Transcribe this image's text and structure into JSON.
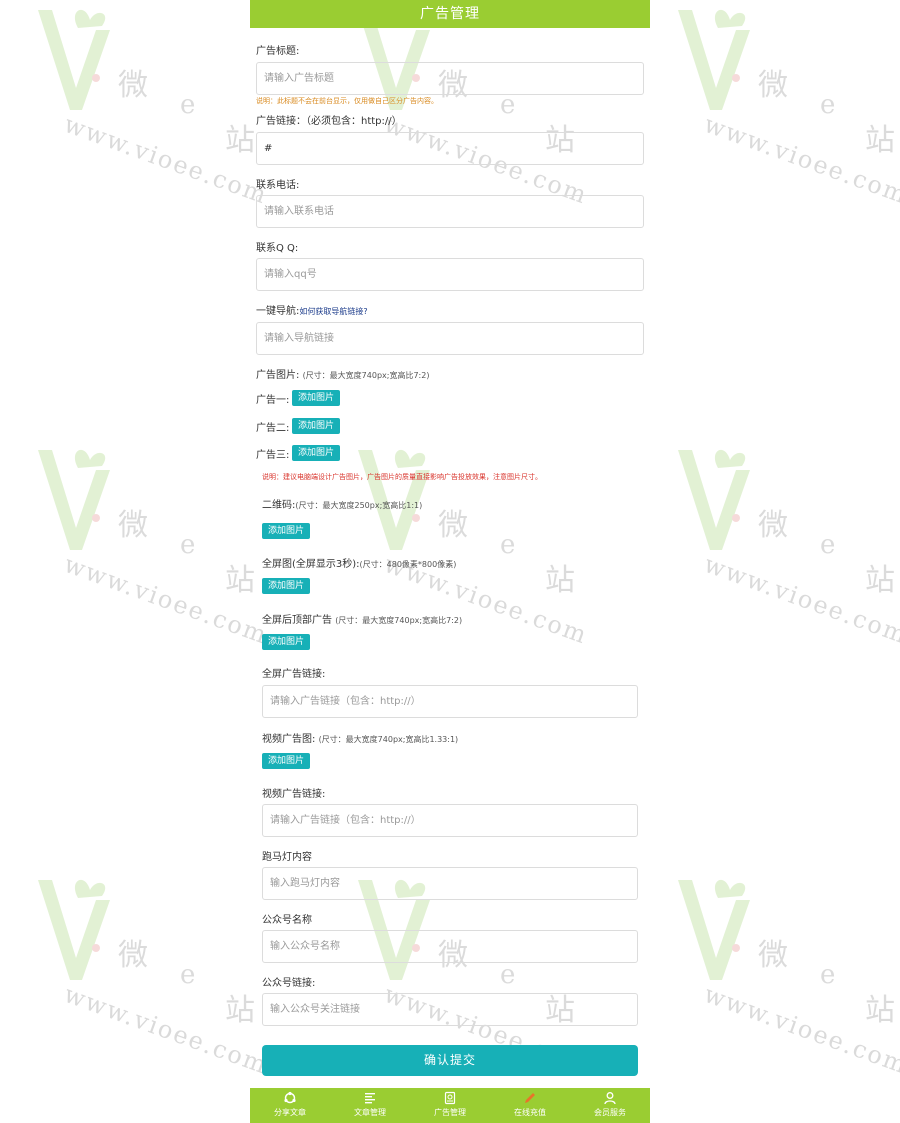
{
  "header": {
    "title": "广告管理"
  },
  "form": {
    "ad_title": {
      "label": "广告标题:",
      "placeholder": "请输入广告标题"
    },
    "ad_title_note": "说明：此标题不会在前台显示，仅用做自己区分广告内容。",
    "ad_link": {
      "label": "广告链接：（必须包含：http://）",
      "value": "#"
    },
    "phone": {
      "label": "联系电话:",
      "placeholder": "请输入联系电话"
    },
    "qq": {
      "label": "联系Q Q:",
      "placeholder": "请输入qq号"
    },
    "nav": {
      "label": "一键导航:",
      "help_link": "如何获取导航链接?",
      "placeholder": "请输入导航链接"
    },
    "ad_image": {
      "label": "广告图片:",
      "hint": "(尺寸：最大宽度740px;宽高比7:2)"
    },
    "ad1_label": "广告一:",
    "ad2_label": "广告二:",
    "ad3_label": "广告三:",
    "add_image_label": "添加图片",
    "image_note": "说明：建议电脑端设计广告图片，广告图片的质量直接影响广告投放效果，注意图片尺寸。",
    "qrcode": {
      "label": "二维码:",
      "hint": "(尺寸：最大宽度250px;宽高比1:1)"
    },
    "fullscreen": {
      "label": "全屏图(全屏显示3秒):",
      "hint": "(尺寸：480像素*800像素)"
    },
    "top_ad": {
      "label": "全屏后顶部广告",
      "hint": "(尺寸：最大宽度740px;宽高比7:2)"
    },
    "fullscreen_link": {
      "label": "全屏广告链接:",
      "placeholder": "请输入广告链接（包含：http://）"
    },
    "video_ad": {
      "label": "视频广告图:",
      "hint": "(尺寸：最大宽度740px;宽高比1.33:1)"
    },
    "video_link": {
      "label": "视频广告链接:",
      "placeholder": "请输入广告链接（包含：http://）"
    },
    "marquee": {
      "label": "跑马灯内容",
      "placeholder": "输入跑马灯内容"
    },
    "account_name": {
      "label": "公众号名称",
      "placeholder": "输入公众号名称"
    },
    "account_link": {
      "label": "公众号链接:",
      "placeholder": "输入公众号关注链接"
    },
    "submit_label": "确认提交"
  },
  "tabbar": [
    {
      "label": "分享文章",
      "icon": "share-icon"
    },
    {
      "label": "文章管理",
      "icon": "list-icon"
    },
    {
      "label": "广告管理",
      "icon": "ad-icon"
    },
    {
      "label": "在线充值",
      "icon": "pencil-icon"
    },
    {
      "label": "会员服务",
      "icon": "user-icon"
    }
  ],
  "watermark": {
    "char_wei": "微",
    "char_e": "e",
    "char_zhan": "站",
    "url": "www.vioee.com"
  },
  "colors": {
    "header": "#9acd32",
    "button": "#17b0b7",
    "note_orange": "#d98a1f",
    "note_red": "#d9332b"
  }
}
